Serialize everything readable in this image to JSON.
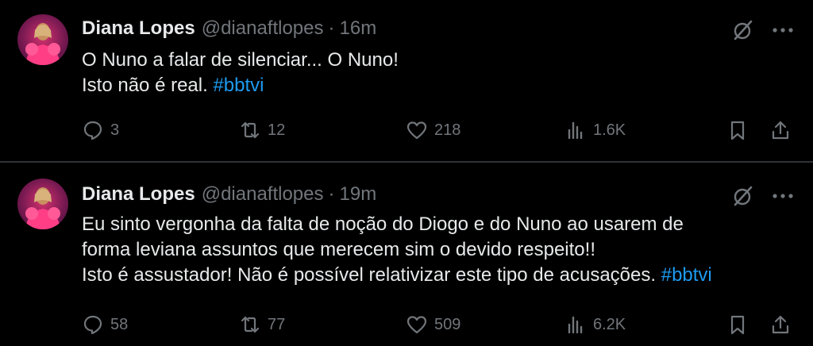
{
  "tweets": [
    {
      "author": {
        "name": "Diana Lopes",
        "handle": "@dianaftlopes"
      },
      "separator": "·",
      "time": "16m",
      "lines": [
        {
          "text": "O Nuno a falar de silenciar... O Nuno!",
          "hashtag": ""
        },
        {
          "text": "Isto não é real. ",
          "hashtag": "#bbtvi"
        }
      ],
      "stats": {
        "replies": "3",
        "reposts": "12",
        "likes": "218",
        "views": "1.6K"
      }
    },
    {
      "author": {
        "name": "Diana Lopes",
        "handle": "@dianaftlopes"
      },
      "separator": "·",
      "time": "19m",
      "lines": [
        {
          "text": "Eu sinto vergonha da falta de noção do Diogo e do Nuno ao usarem de",
          "hashtag": ""
        },
        {
          "text": "forma leviana assuntos que merecem sim o devido respeito!!",
          "hashtag": ""
        },
        {
          "text": "Isto é assustador! Não é possível relativizar este tipo de acusações. ",
          "hashtag": "#bbtvi"
        }
      ],
      "stats": {
        "replies": "58",
        "reposts": "77",
        "likes": "509",
        "views": "6.2K"
      }
    }
  ],
  "colors": {
    "background": "#000000",
    "text": "#e7e9ea",
    "muted": "#71767b",
    "link": "#1d9bf0",
    "divider": "#2f3336"
  },
  "icons": [
    "avatar",
    "grok-icon",
    "more-icon",
    "reply-icon",
    "repost-icon",
    "like-icon",
    "views-icon",
    "bookmark-icon",
    "share-icon"
  ]
}
